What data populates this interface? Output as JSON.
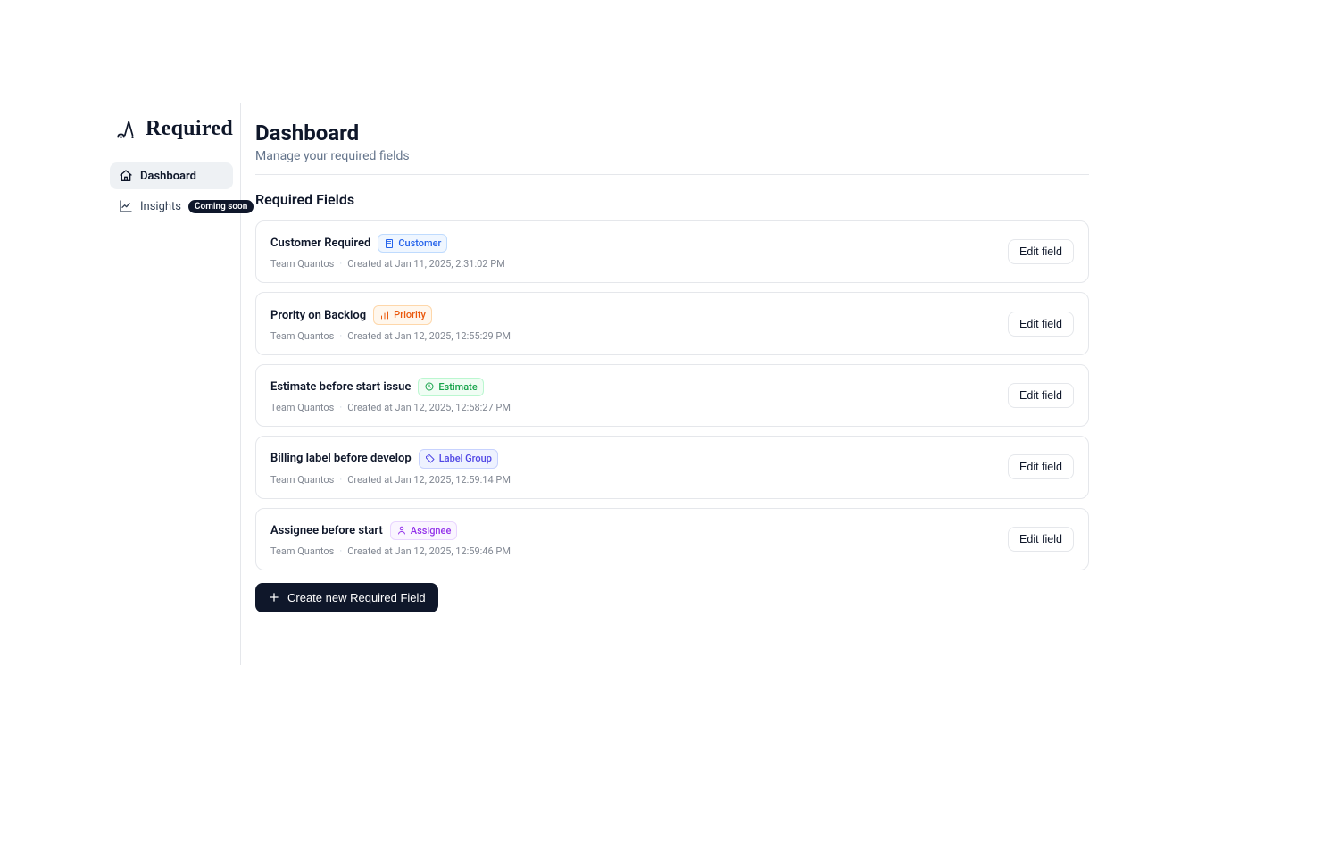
{
  "brand": {
    "name": "Required"
  },
  "sidebar": {
    "items": [
      {
        "label": "Dashboard"
      },
      {
        "label": "Insights",
        "badge": "Coming soon"
      }
    ]
  },
  "header": {
    "title": "Dashboard",
    "subtitle": "Manage your required fields"
  },
  "section": {
    "title": "Required Fields"
  },
  "fields": [
    {
      "title": "Customer Required",
      "tag": {
        "label": "Customer",
        "color": "blue",
        "icon": "building-icon"
      },
      "team": "Team Quantos",
      "created": "Created at Jan 11, 2025, 2:31:02 PM",
      "action": "Edit field"
    },
    {
      "title": "Prority on Backlog",
      "tag": {
        "label": "Priority",
        "color": "orange",
        "icon": "bars-icon"
      },
      "team": "Team Quantos",
      "created": "Created at Jan 12, 2025, 12:55:29 PM",
      "action": "Edit field"
    },
    {
      "title": "Estimate before start issue",
      "tag": {
        "label": "Estimate",
        "color": "green",
        "icon": "clock-icon"
      },
      "team": "Team Quantos",
      "created": "Created at Jan 12, 2025, 12:58:27 PM",
      "action": "Edit field"
    },
    {
      "title": "Billing label before develop",
      "tag": {
        "label": "Label Group",
        "color": "indigo",
        "icon": "tags-icon"
      },
      "team": "Team Quantos",
      "created": "Created at Jan 12, 2025, 12:59:14 PM",
      "action": "Edit field"
    },
    {
      "title": "Assignee before start",
      "tag": {
        "label": "Assignee",
        "color": "purple",
        "icon": "user-icon"
      },
      "team": "Team Quantos",
      "created": "Created at Jan 12, 2025, 12:59:46 PM",
      "action": "Edit field"
    }
  ],
  "create_button": "Create new Required Field"
}
